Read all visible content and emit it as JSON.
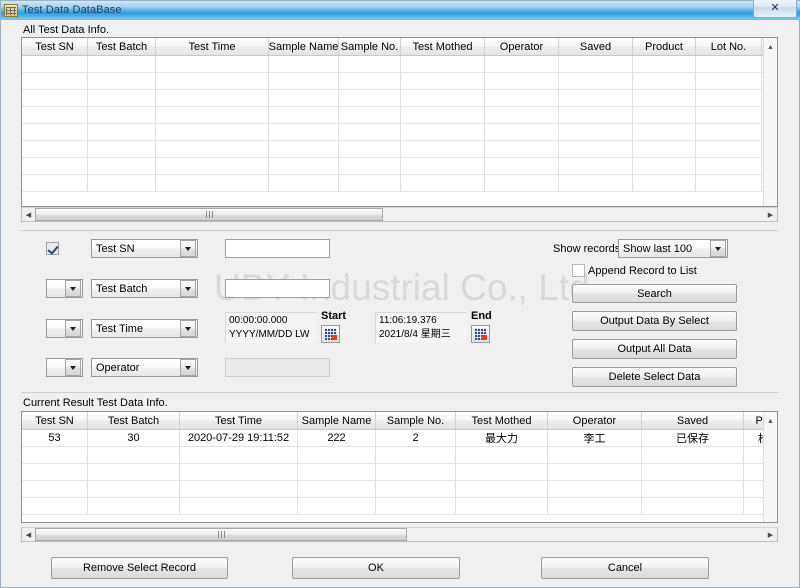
{
  "window": {
    "title": "Test Data DataBase",
    "icon": "grid-app-icon",
    "close_label": "✕"
  },
  "top_section": {
    "label": "All Test Data Info.",
    "columns": [
      "Test SN",
      "Test Batch",
      "Test Time",
      "Sample Name",
      "Sample No.",
      "Test Mothed",
      "Operator",
      "Saved",
      "Product",
      "Lot No."
    ],
    "rows": [],
    "empty_row_count": 8,
    "scroll": {
      "up_arrow": "▲",
      "left_arrow": "◀",
      "right_arrow": "▶"
    }
  },
  "filters": {
    "rows": [
      {
        "enabled_checkbox": true,
        "enable_combo_value": "",
        "field_combo_value": "Test SN",
        "value_input": "",
        "value_input_disabled": false
      },
      {
        "enabled_checkbox": false,
        "enable_combo_value": "",
        "field_combo_value": "Test Batch",
        "value_input": "",
        "value_input_disabled": false
      },
      {
        "enabled_checkbox": false,
        "enable_combo_value": "",
        "field_combo_value": "Test Time",
        "value_input": "",
        "value_input_disabled": false
      },
      {
        "enabled_checkbox": false,
        "enable_combo_value": "",
        "field_combo_value": "Operator",
        "value_input": "",
        "value_input_disabled": true
      }
    ],
    "start_picker": {
      "time": "00:00:00.000",
      "date": "YYYY/MM/DD LW",
      "label": "Start"
    },
    "end_picker": {
      "time": "11:06:19.376",
      "date": "2021/8/4 星期三",
      "label": "End"
    },
    "show_records_label": "Show records",
    "show_records_value": "Show last 100",
    "append_record_label": "Append Record to List",
    "append_record_checked": false,
    "buttons": {
      "search": "Search",
      "output_by_select": "Output Data By Select",
      "output_all": "Output All Data",
      "delete_select": "Delete Select Data"
    }
  },
  "watermark": "UBY Industrial Co., Ltd",
  "bottom_section": {
    "label": "Current Result Test Data Info.",
    "columns": [
      "Test SN",
      "Test Batch",
      "Test Time",
      "Sample Name",
      "Sample No.",
      "Test Mothed",
      "Operator",
      "Saved",
      "Product"
    ],
    "rows": [
      {
        "test_sn": "53",
        "test_batch": "30",
        "test_time": "2020-07-29 19:11:52",
        "sample_name": "222",
        "sample_no": "2",
        "test_mothed": "最大力",
        "operator": "李工",
        "saved": "已保存",
        "product": "松紧带"
      }
    ],
    "empty_row_count": 4,
    "scroll": {
      "up_arrow": "▲",
      "left_arrow": "◀",
      "right_arrow": "▶"
    }
  },
  "footer": {
    "remove_select_record": "Remove Select Record",
    "ok": "OK",
    "cancel": "Cancel"
  },
  "colors": {
    "titlebar_accent": "#2f9ddf",
    "window_bg": "#f0f0f0",
    "grid_bg": "#ffffff",
    "border": "#8f8f8f"
  }
}
